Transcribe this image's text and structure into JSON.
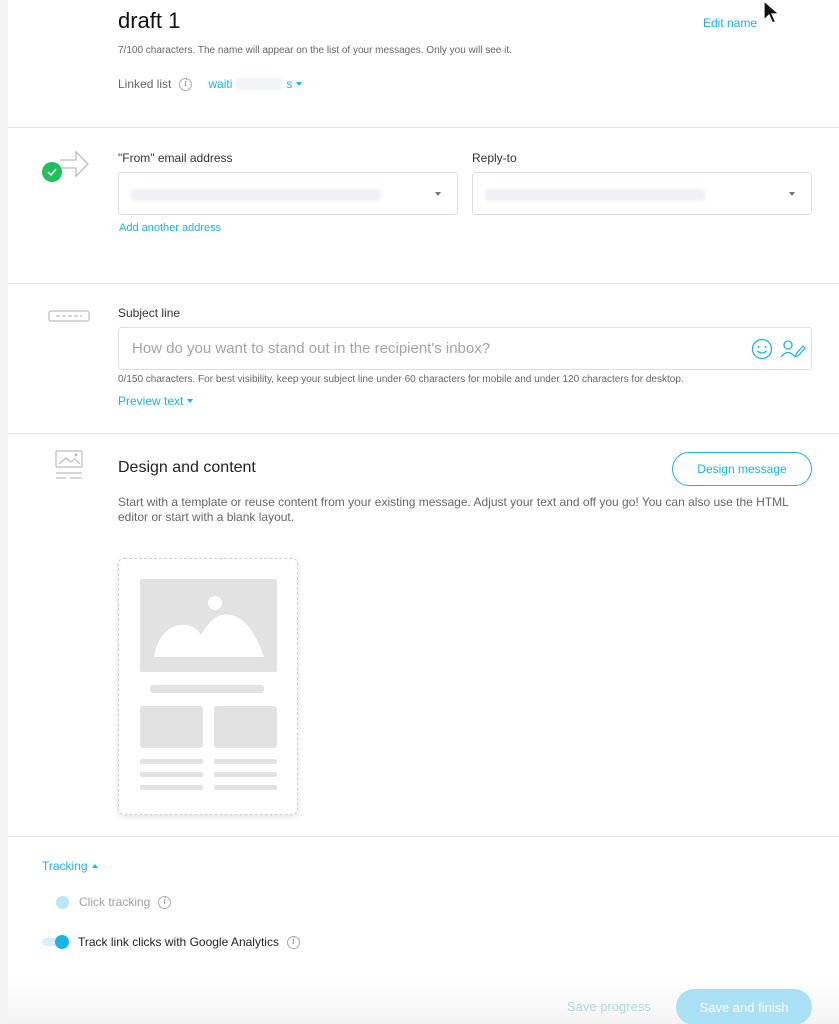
{
  "message": {
    "title": "draft 1",
    "edit_name": "Edit name",
    "name_help": "7/100 characters. The name will appear on the list of your messages. Only you will see it.",
    "linked_list_label": "Linked list",
    "linked_list_value_start": "waiti",
    "linked_list_value_end": "s"
  },
  "from": {
    "from_label": "\"From\" email address",
    "reply_label": "Reply-to",
    "add_address": "Add another address",
    "status_color": "#20c05c"
  },
  "subject": {
    "label": "Subject line",
    "placeholder": "How do you want to stand out in the recipient's inbox?",
    "help": "0/150 characters. For best visibility, keep your subject line under 60 characters for mobile and under 120 characters for desktop.",
    "preview_text": "Preview text"
  },
  "design": {
    "title": "Design and content",
    "button": "Design message",
    "help": "Start with a template or reuse content from your existing message. Adjust your text and off you go! You can also use the HTML editor or start with a blank layout."
  },
  "tracking": {
    "toggle_label": "Tracking",
    "click_tracking": "Click tracking",
    "ga_tracking": "Track link clicks with Google Analytics",
    "ga_enabled": true
  },
  "footer": {
    "save_progress": "Save progress",
    "save_finish": "Save and finish"
  },
  "colors": {
    "accent": "#1ab3e6",
    "success": "#20c05c"
  }
}
